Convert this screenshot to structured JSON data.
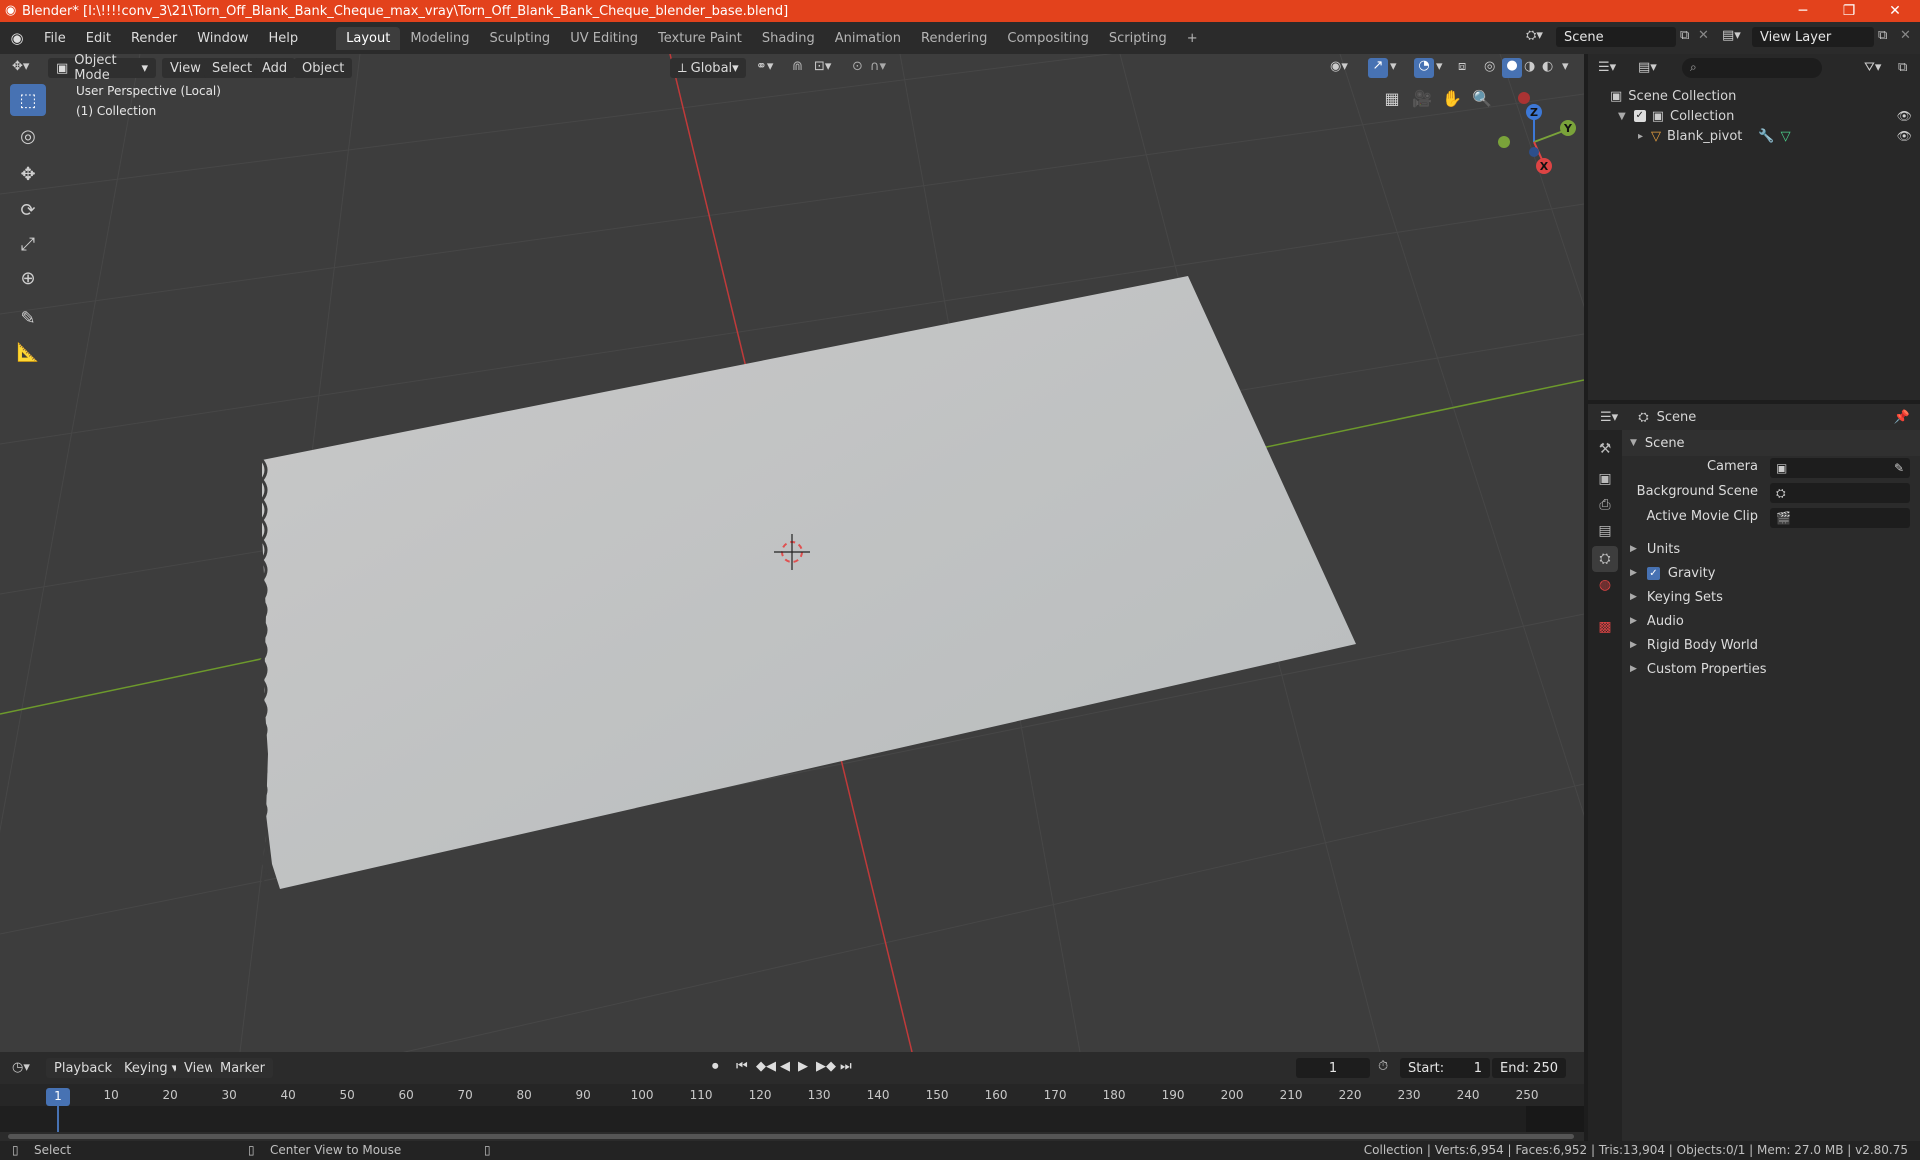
{
  "window": {
    "title": "Blender* [I:\\!!!!conv_3\\21\\Torn_Off_Blank_Bank_Cheque_max_vray\\Torn_Off_Blank_Bank_Cheque_blender_base.blend]",
    "controls": {
      "minimize": "─",
      "maximize": "❐",
      "close": "✕"
    }
  },
  "menu": {
    "items": [
      "File",
      "Edit",
      "Render",
      "Window",
      "Help"
    ]
  },
  "workspaces": {
    "tabs": [
      "Layout",
      "Modeling",
      "Sculpting",
      "UV Editing",
      "Texture Paint",
      "Shading",
      "Animation",
      "Rendering",
      "Compositing",
      "Scripting"
    ],
    "active": "Layout",
    "add_label": "+"
  },
  "top_right": {
    "scene": "Scene",
    "view_layer": "View Layer"
  },
  "viewport_header": {
    "mode": "Object Mode",
    "menus": [
      "View",
      "Select",
      "Add",
      "Object"
    ],
    "orientation": "Global"
  },
  "viewport": {
    "info_line1": "User Perspective (Local)",
    "info_line2": "(1) Collection",
    "gizmo": {
      "z": "Z",
      "y": "Y",
      "x": "X"
    }
  },
  "outliner": {
    "search_placeholder": "",
    "items": [
      {
        "label": "Scene Collection"
      },
      {
        "label": "Collection"
      },
      {
        "label": "Blank_pivot"
      }
    ]
  },
  "properties": {
    "header": "Scene",
    "panel_title": "Scene",
    "fields": [
      {
        "label": "Camera"
      },
      {
        "label": "Background Scene"
      },
      {
        "label": "Active Movie Clip"
      }
    ],
    "sections": [
      "Units",
      "Gravity",
      "Keying Sets",
      "Audio",
      "Rigid Body World",
      "Custom Properties"
    ],
    "gravity_checked": true
  },
  "timeline": {
    "menus": [
      "Playback",
      "Keying",
      "View",
      "Marker"
    ],
    "current_frame": "1",
    "start_label": "Start:",
    "start_value": "1",
    "end_label": "End:",
    "end_value": "250",
    "ruler": [
      "1",
      "10",
      "20",
      "30",
      "40",
      "50",
      "60",
      "70",
      "80",
      "90",
      "100",
      "110",
      "120",
      "130",
      "140",
      "150",
      "160",
      "170",
      "180",
      "190",
      "200",
      "210",
      "220",
      "230",
      "240",
      "250"
    ]
  },
  "status": {
    "select": "Select",
    "center_view": "Center View to Mouse",
    "stats": "Collection | Verts:6,954 | Faces:6,952 | Tris:13,904 | Objects:0/1 | Mem: 27.0 MB | v2.80.75"
  },
  "colors": {
    "title_bar": "#e3421c",
    "accent": "#4772b3",
    "viewport_bg": "#3d3d3d",
    "x_axis": "#c03a3a",
    "y_axis": "#6d9a2c"
  }
}
